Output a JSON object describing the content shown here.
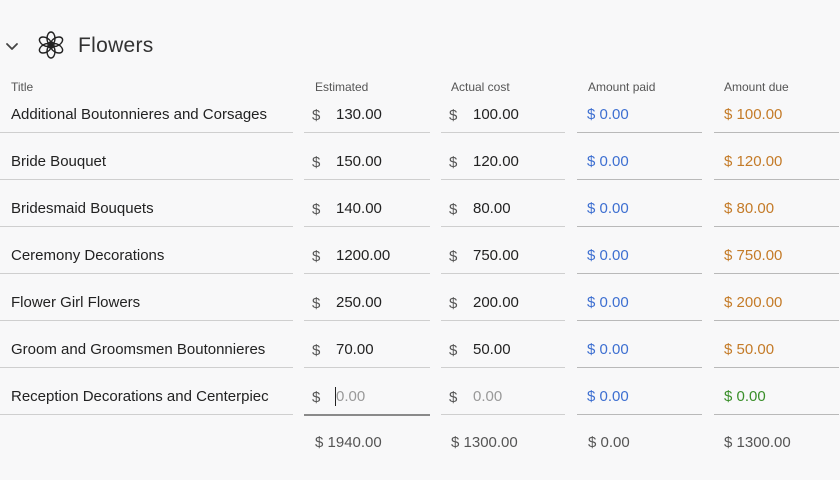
{
  "section": {
    "title": "Flowers"
  },
  "columns": {
    "title": "Title",
    "estimated": "Estimated",
    "actual": "Actual cost",
    "paid": "Amount paid",
    "due": "Amount due"
  },
  "currency_symbol": "$",
  "rows": [
    {
      "title": "Additional Boutonnieres and Corsages",
      "estimated": "130.00",
      "actual": "100.00",
      "paid": "$ 0.00",
      "due": "$ 100.00"
    },
    {
      "title": "Bride Bouquet",
      "estimated": "150.00",
      "actual": "120.00",
      "paid": "$ 0.00",
      "due": "$ 120.00"
    },
    {
      "title": "Bridesmaid Bouquets",
      "estimated": "140.00",
      "actual": "80.00",
      "paid": "$ 0.00",
      "due": "$ 80.00"
    },
    {
      "title": "Ceremony Decorations",
      "estimated": "1200.00",
      "actual": "750.00",
      "paid": "$ 0.00",
      "due": "$ 750.00"
    },
    {
      "title": "Flower Girl Flowers",
      "estimated": "250.00",
      "actual": "200.00",
      "paid": "$ 0.00",
      "due": "$ 200.00"
    },
    {
      "title": "Groom and Groomsmen Boutonnieres",
      "estimated": "70.00",
      "actual": "50.00",
      "paid": "$ 0.00",
      "due": "$ 50.00"
    },
    {
      "title": "Reception Decorations and Centerpiec",
      "estimated_placeholder": "0.00",
      "actual_placeholder": "0.00",
      "paid": "$ 0.00",
      "due": "$ 0.00"
    }
  ],
  "totals": {
    "estimated": "$ 1940.00",
    "actual": "$ 1300.00",
    "paid": "$ 0.00",
    "due": "$ 1300.00"
  },
  "colors": {
    "paid": "#3d6fd1",
    "due": "#c47b28",
    "due_zero": "#3a8f2a"
  }
}
